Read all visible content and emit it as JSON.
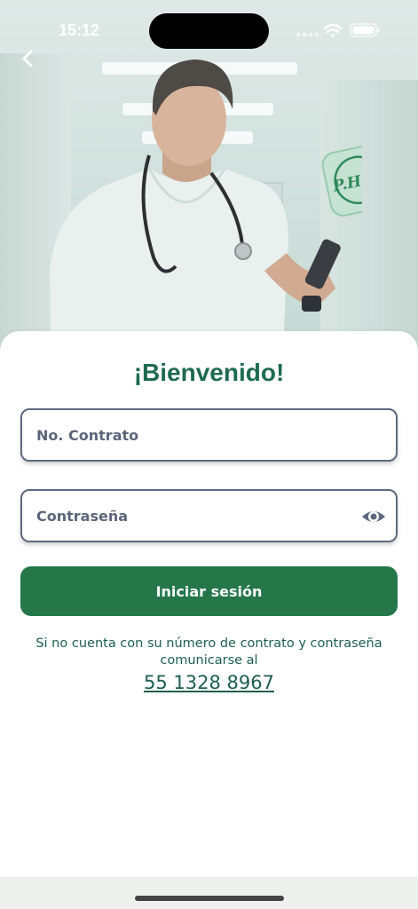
{
  "status_bar": {
    "time": "15:12"
  },
  "hero": {
    "badge_text": "P.H.N."
  },
  "login": {
    "title": "¡Bienvenido!",
    "contract_placeholder": "No. Contrato",
    "password_placeholder": "Contraseña",
    "submit_label": "Iniciar sesión"
  },
  "help": {
    "message": "Si no cuenta con su número de contrato y contraseña comunicarse al",
    "phone": "55 1328 8967"
  },
  "colors": {
    "primary": "#25774a",
    "title": "#1e6b4e",
    "text": "#1e5f4c",
    "field_border": "#5d6a80"
  },
  "icons": [
    "chevron-left-icon",
    "signal-icon",
    "wifi-icon",
    "battery-icon",
    "eye-icon"
  ]
}
